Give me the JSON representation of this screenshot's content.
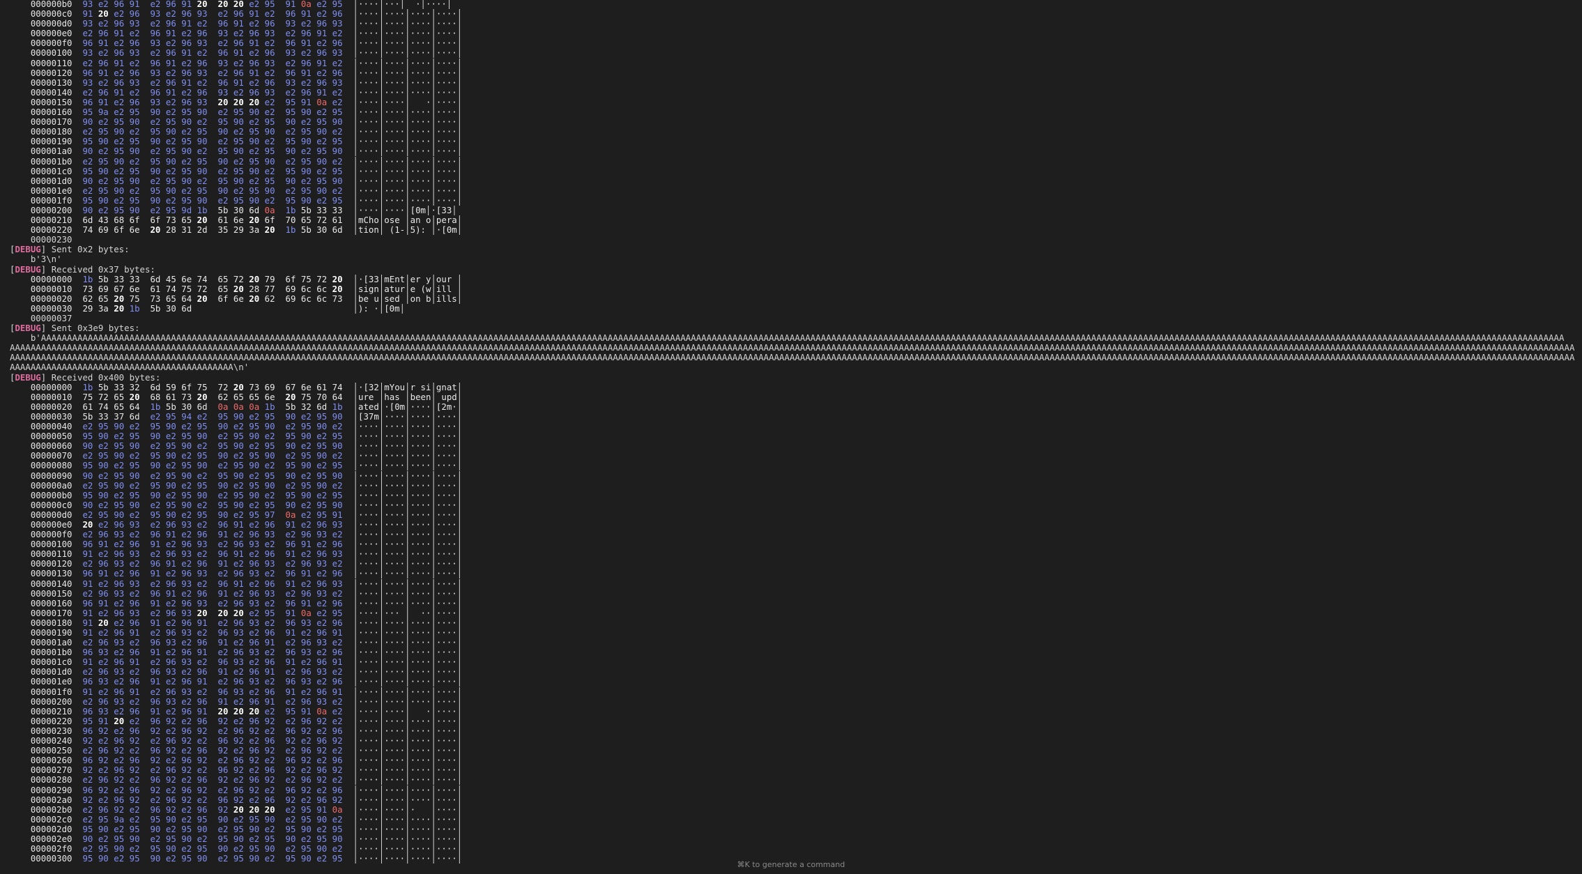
{
  "hint": "⌘K to generate a command",
  "lines": [
    "    000000b0  93 e2 96 91  e2 96 91 20  20 20 e2 95  91 0a e2 95  │····│···│  ·│····│",
    "    000000c0  91 20 e2 96  93 e2 96 93  e2 96 91 e2  96 91 e2 96  │····│····│····│····│",
    "    000000d0  93 e2 96 93  e2 96 91 e2  96 91 e2 96  93 e2 96 93  │····│····│····│····│",
    "    000000e0  e2 96 91 e2  96 91 e2 96  93 e2 96 93  e2 96 91 e2  │····│····│····│····│",
    "    000000f0  96 91 e2 96  93 e2 96 93  e2 96 91 e2  96 91 e2 96  │····│····│····│····│",
    "    00000100  93 e2 96 93  e2 96 91 e2  96 91 e2 96  93 e2 96 93  │····│····│····│····│",
    "    00000110  e2 96 91 e2  96 91 e2 96  93 e2 96 93  e2 96 91 e2  │····│····│····│····│",
    "    00000120  96 91 e2 96  93 e2 96 93  e2 96 91 e2  96 91 e2 96  │····│····│····│····│",
    "    00000130  93 e2 96 93  e2 96 91 e2  96 91 e2 96  93 e2 96 93  │····│····│····│····│",
    "    00000140  e2 96 91 e2  96 91 e2 96  93 e2 96 93  e2 96 91 e2  │····│····│····│····│",
    "    00000150  96 91 e2 96  93 e2 96 93  20 20 20 e2  95 91 0a e2  │····│····│   ·│····│",
    "    00000160  95 9a e2 95  90 e2 95 90  e2 95 90 e2  95 90 e2 95  │····│····│····│····│",
    "    00000170  90 e2 95 90  e2 95 90 e2  95 90 e2 95  90 e2 95 90  │····│····│····│····│",
    "    00000180  e2 95 90 e2  95 90 e2 95  90 e2 95 90  e2 95 90 e2  │····│····│····│····│",
    "    00000190  95 90 e2 95  90 e2 95 90  e2 95 90 e2  95 90 e2 95  │····│····│····│····│",
    "    000001a0  90 e2 95 90  e2 95 90 e2  95 90 e2 95  90 e2 95 90  │····│····│····│····│",
    "    000001b0  e2 95 90 e2  95 90 e2 95  90 e2 95 90  e2 95 90 e2  │····│····│····│····│",
    "    000001c0  95 90 e2 95  90 e2 95 90  e2 95 90 e2  95 90 e2 95  │····│····│····│····│",
    "    000001d0  90 e2 95 90  e2 95 90 e2  95 90 e2 95  90 e2 95 90  │····│····│····│····│",
    "    000001e0  e2 95 90 e2  95 90 e2 95  90 e2 95 90  e2 95 90 e2  │····│····│····│····│",
    "    000001f0  95 90 e2 95  90 e2 95 90  e2 95 90 e2  95 90 e2 95  │····│····│····│····│",
    "    00000200  90 e2 95 90  e2 95 9d 1b  5b 30 6d 0a  1b 5b 33 33  │····│····│[0m│·[33│",
    "    00000210  6d 43 68 6f  6f 73 65 20  61 6e 20 6f  70 65 72 61  │mCho│ose │an o│pera│",
    "    00000220  74 69 6f 6e  20 28 31 2d  35 29 3a 20  1b 5b 30 6d  │tion│ (1-│5): │·[0m│",
    "    00000230",
    "[DEBUG] Sent 0x2 bytes:",
    "    b'3\\n'",
    "[DEBUG] Received 0x37 bytes:",
    "    00000000  1b 5b 33 33  6d 45 6e 74  65 72 20 79  6f 75 72 20  │·[33│mEnt│er y│our │",
    "    00000010  73 69 67 6e  61 74 75 72  65 20 28 77  69 6c 6c 20  │sign│atur│e (w│ill │",
    "    00000020  62 65 20 75  73 65 64 20  6f 6e 20 62  69 6c 6c 73  │be u│sed │on b│ills│",
    "    00000030  29 3a 20 1b  5b 30 6d                               │): ·│[0m│",
    "    00000037",
    "[DEBUG] Sent 0x3e9 bytes:",
    "    b'AAAAAAAAAAAAAAAAAAAAAAAAAAAAAAAAAAAAAAAAAAAAAAAAAAAAAAAAAAAAAAAAAAAAAAAAAAAAAAAAAAAAAAAAAAAAAAAAAAAAAAAAAAAAAAAAAAAAAAAAAAAAAAAAAAAAAAAAAAAAAAAAAAAAAAAAAAAAAAAAAAAAAAAAAAAAAAAAAAAAAAAAAAAAAAAAAAAAAAAAAAAAAAAAAAAAAAAAAAAAAAAAAAAAAAAAAAAAAAAAAAAAAAAAAAAAAAAAAAAAAAAAAAAAAAAAAAAAAAAAAAAAAAAAAAAAA",
    "AAAAAAAAAAAAAAAAAAAAAAAAAAAAAAAAAAAAAAAAAAAAAAAAAAAAAAAAAAAAAAAAAAAAAAAAAAAAAAAAAAAAAAAAAAAAAAAAAAAAAAAAAAAAAAAAAAAAAAAAAAAAAAAAAAAAAAAAAAAAAAAAAAAAAAAAAAAAAAAAAAAAAAAAAAAAAAAAAAAAAAAAAAAAAAAAAAAAAAAAAAAAAAAAAAAAAAAAAAAAAAAAAAAAAAAAAAAAAAAAAAAAAAAAAAAAAAAAAAAAAAAAAAAAAAAAAAAAAAAAAAAAAAAAAAAAAAAAAAAAA",
    "AAAAAAAAAAAAAAAAAAAAAAAAAAAAAAAAAAAAAAAAAAAAAAAAAAAAAAAAAAAAAAAAAAAAAAAAAAAAAAAAAAAAAAAAAAAAAAAAAAAAAAAAAAAAAAAAAAAAAAAAAAAAAAAAAAAAAAAAAAAAAAAAAAAAAAAAAAAAAAAAAAAAAAAAAAAAAAAAAAAAAAAAAAAAAAAAAAAAAAAAAAAAAAAAAAAAAAAAAAAAAAAAAAAAAAAAAAAAAAAAAAAAAAAAAAAAAAAAAAAAAAAAAAAAAAAAAAAAAAAAAAAAAAAAAAAAAAAAAAAAA",
    "AAAAAAAAAAAAAAAAAAAAAAAAAAAAAAAAAAAAAAAAAAA\\n'",
    "[DEBUG] Received 0x400 bytes:",
    "    00000000  1b 5b 33 32  6d 59 6f 75  72 20 73 69  67 6e 61 74  │·[32│mYou│r si│gnat│",
    "    00000010  75 72 65 20  68 61 73 20  62 65 65 6e  20 75 70 64  │ure │has │been│ upd│",
    "    00000020  61 74 65 64  1b 5b 30 6d  0a 0a 0a 1b  5b 32 6d 1b  │ated│·[0m│····│[2m·│",
    "    00000030  5b 33 37 6d  e2 95 94 e2  95 90 e2 95  90 e2 95 90  │[37m│····│····│····│",
    "    00000040  e2 95 90 e2  95 90 e2 95  90 e2 95 90  e2 95 90 e2  │····│····│····│····│",
    "    00000050  95 90 e2 95  90 e2 95 90  e2 95 90 e2  95 90 e2 95  │····│····│····│····│",
    "    00000060  90 e2 95 90  e2 95 90 e2  95 90 e2 95  90 e2 95 90  │····│····│····│····│",
    "    00000070  e2 95 90 e2  95 90 e2 95  90 e2 95 90  e2 95 90 e2  │····│····│····│····│",
    "    00000080  95 90 e2 95  90 e2 95 90  e2 95 90 e2  95 90 e2 95  │····│····│····│····│",
    "    00000090  90 e2 95 90  e2 95 90 e2  95 90 e2 95  90 e2 95 90  │····│····│····│····│",
    "    000000a0  e2 95 90 e2  95 90 e2 95  90 e2 95 90  e2 95 90 e2  │····│····│····│····│",
    "    000000b0  95 90 e2 95  90 e2 95 90  e2 95 90 e2  95 90 e2 95  │····│····│····│····│",
    "    000000c0  90 e2 95 90  e2 95 90 e2  95 90 e2 95  90 e2 95 90  │····│····│····│····│",
    "    000000d0  e2 95 90 e2  95 90 e2 95  90 e2 95 97  0a e2 95 91  │····│····│····│····│",
    "    000000e0  20 e2 96 93  e2 96 93 e2  96 91 e2 96  91 e2 96 93  │····│····│····│····│",
    "    000000f0  e2 96 93 e2  96 91 e2 96  91 e2 96 93  e2 96 93 e2  │····│····│····│····│",
    "    00000100  96 91 e2 96  91 e2 96 93  e2 96 93 e2  96 91 e2 96  │····│····│····│····│",
    "    00000110  91 e2 96 93  e2 96 93 e2  96 91 e2 96  91 e2 96 93  │····│····│····│····│",
    "    00000120  e2 96 93 e2  96 91 e2 96  91 e2 96 93  e2 96 93 e2  │····│····│····│····│",
    "    00000130  96 91 e2 96  91 e2 96 93  e2 96 93 e2  96 91 e2 96  │····│····│····│····│",
    "    00000140  91 e2 96 93  e2 96 93 e2  96 91 e2 96  91 e2 96 93  │····│····│····│····│",
    "    00000150  e2 96 93 e2  96 91 e2 96  91 e2 96 93  e2 96 93 e2  │····│····│····│····│",
    "    00000160  96 91 e2 96  91 e2 96 93  e2 96 93 e2  96 91 e2 96  │····│····│····│····│",
    "    00000170  91 e2 96 93  e2 96 93 20  20 20 e2 95  91 0a e2 95  │····│··· │  ··│····│",
    "    00000180  91 20 e2 96  91 e2 96 91  e2 96 93 e2  96 93 e2 96  │····│····│····│····│",
    "    00000190  91 e2 96 91  e2 96 93 e2  96 93 e2 96  91 e2 96 91  │····│····│····│····│",
    "    000001a0  e2 96 93 e2  96 93 e2 96  91 e2 96 91  e2 96 93 e2  │····│····│····│····│",
    "    000001b0  96 93 e2 96  91 e2 96 91  e2 96 93 e2  96 93 e2 96  │····│····│····│····│",
    "    000001c0  91 e2 96 91  e2 96 93 e2  96 93 e2 96  91 e2 96 91  │····│····│····│····│",
    "    000001d0  e2 96 93 e2  96 93 e2 96  91 e2 96 91  e2 96 93 e2  │····│····│····│····│",
    "    000001e0  96 93 e2 96  91 e2 96 91  e2 96 93 e2  96 93 e2 96  │····│····│····│····│",
    "    000001f0  91 e2 96 91  e2 96 93 e2  96 93 e2 96  91 e2 96 91  │····│····│····│····│",
    "    00000200  e2 96 93 e2  96 93 e2 96  91 e2 96 91  e2 96 93 e2  │····│····│····│····│",
    "    00000210  96 93 e2 96  91 e2 96 91  20 20 20 e2  95 91 0a e2  │····│····│   ·│····│",
    "    00000220  95 91 20 e2  96 92 e2 96  92 e2 96 92  e2 96 92 e2  │····│····│····│····│",
    "    00000230  96 92 e2 96  92 e2 96 92  e2 96 92 e2  96 92 e2 96  │····│····│····│····│",
    "    00000240  92 e2 96 92  e2 96 92 e2  96 92 e2 96  92 e2 96 92  │····│····│····│····│",
    "    00000250  e2 96 92 e2  96 92 e2 96  92 e2 96 92  e2 96 92 e2  │····│····│····│····│",
    "    00000260  96 92 e2 96  92 e2 96 92  e2 96 92 e2  96 92 e2 96  │····│····│····│····│",
    "    00000270  92 e2 96 92  e2 96 92 e2  96 92 e2 96  92 e2 96 92  │····│····│····│····│",
    "    00000280  e2 96 92 e2  96 92 e2 96  92 e2 96 92  e2 96 92 e2  │····│····│····│····│",
    "    00000290  96 92 e2 96  92 e2 96 92  e2 96 92 e2  96 92 e2 96  │····│····│····│····│",
    "    000002a0  92 e2 96 92  e2 96 92 e2  96 92 e2 96  92 e2 96 92  │····│····│····│····│",
    "    000002b0  e2 96 92 e2  96 92 e2 96  92 20 20 20  e2 95 91 0a  │····│····│·   │····│",
    "    000002c0  e2 95 9a e2  95 90 e2 95  90 e2 95 90  e2 95 90 e2  │····│····│····│····│",
    "    000002d0  95 90 e2 95  90 e2 95 90  e2 95 90 e2  95 90 e2 95  │····│····│····│····│",
    "    000002e0  90 e2 95 90  e2 95 90 e2  95 90 e2 95  90 e2 95 90  │····│····│····│····│",
    "    000002f0  e2 95 90 e2  95 90 e2 95  90 e2 95 90  e2 95 90 e2  │····│····│····│····│",
    "    00000300  95 90 e2 95  90 e2 95 90  e2 95 90 e2  95 90 e2 95  │····│····│····│····│"
  ]
}
